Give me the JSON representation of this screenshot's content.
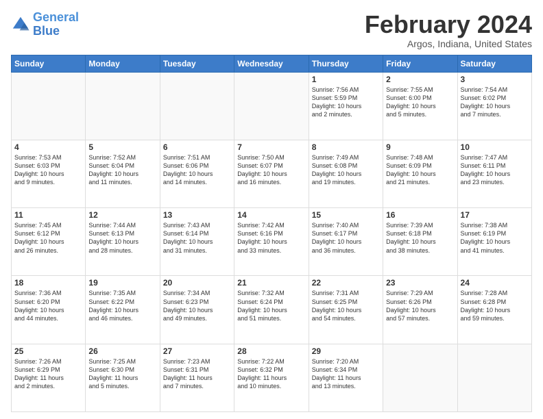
{
  "logo": {
    "line1": "General",
    "line2": "Blue"
  },
  "title": "February 2024",
  "subtitle": "Argos, Indiana, United States",
  "days_of_week": [
    "Sunday",
    "Monday",
    "Tuesday",
    "Wednesday",
    "Thursday",
    "Friday",
    "Saturday"
  ],
  "weeks": [
    [
      {
        "day": "",
        "info": ""
      },
      {
        "day": "",
        "info": ""
      },
      {
        "day": "",
        "info": ""
      },
      {
        "day": "",
        "info": ""
      },
      {
        "day": "1",
        "info": "Sunrise: 7:56 AM\nSunset: 5:59 PM\nDaylight: 10 hours\nand 2 minutes."
      },
      {
        "day": "2",
        "info": "Sunrise: 7:55 AM\nSunset: 6:00 PM\nDaylight: 10 hours\nand 5 minutes."
      },
      {
        "day": "3",
        "info": "Sunrise: 7:54 AM\nSunset: 6:02 PM\nDaylight: 10 hours\nand 7 minutes."
      }
    ],
    [
      {
        "day": "4",
        "info": "Sunrise: 7:53 AM\nSunset: 6:03 PM\nDaylight: 10 hours\nand 9 minutes."
      },
      {
        "day": "5",
        "info": "Sunrise: 7:52 AM\nSunset: 6:04 PM\nDaylight: 10 hours\nand 11 minutes."
      },
      {
        "day": "6",
        "info": "Sunrise: 7:51 AM\nSunset: 6:06 PM\nDaylight: 10 hours\nand 14 minutes."
      },
      {
        "day": "7",
        "info": "Sunrise: 7:50 AM\nSunset: 6:07 PM\nDaylight: 10 hours\nand 16 minutes."
      },
      {
        "day": "8",
        "info": "Sunrise: 7:49 AM\nSunset: 6:08 PM\nDaylight: 10 hours\nand 19 minutes."
      },
      {
        "day": "9",
        "info": "Sunrise: 7:48 AM\nSunset: 6:09 PM\nDaylight: 10 hours\nand 21 minutes."
      },
      {
        "day": "10",
        "info": "Sunrise: 7:47 AM\nSunset: 6:11 PM\nDaylight: 10 hours\nand 23 minutes."
      }
    ],
    [
      {
        "day": "11",
        "info": "Sunrise: 7:45 AM\nSunset: 6:12 PM\nDaylight: 10 hours\nand 26 minutes."
      },
      {
        "day": "12",
        "info": "Sunrise: 7:44 AM\nSunset: 6:13 PM\nDaylight: 10 hours\nand 28 minutes."
      },
      {
        "day": "13",
        "info": "Sunrise: 7:43 AM\nSunset: 6:14 PM\nDaylight: 10 hours\nand 31 minutes."
      },
      {
        "day": "14",
        "info": "Sunrise: 7:42 AM\nSunset: 6:16 PM\nDaylight: 10 hours\nand 33 minutes."
      },
      {
        "day": "15",
        "info": "Sunrise: 7:40 AM\nSunset: 6:17 PM\nDaylight: 10 hours\nand 36 minutes."
      },
      {
        "day": "16",
        "info": "Sunrise: 7:39 AM\nSunset: 6:18 PM\nDaylight: 10 hours\nand 38 minutes."
      },
      {
        "day": "17",
        "info": "Sunrise: 7:38 AM\nSunset: 6:19 PM\nDaylight: 10 hours\nand 41 minutes."
      }
    ],
    [
      {
        "day": "18",
        "info": "Sunrise: 7:36 AM\nSunset: 6:20 PM\nDaylight: 10 hours\nand 44 minutes."
      },
      {
        "day": "19",
        "info": "Sunrise: 7:35 AM\nSunset: 6:22 PM\nDaylight: 10 hours\nand 46 minutes."
      },
      {
        "day": "20",
        "info": "Sunrise: 7:34 AM\nSunset: 6:23 PM\nDaylight: 10 hours\nand 49 minutes."
      },
      {
        "day": "21",
        "info": "Sunrise: 7:32 AM\nSunset: 6:24 PM\nDaylight: 10 hours\nand 51 minutes."
      },
      {
        "day": "22",
        "info": "Sunrise: 7:31 AM\nSunset: 6:25 PM\nDaylight: 10 hours\nand 54 minutes."
      },
      {
        "day": "23",
        "info": "Sunrise: 7:29 AM\nSunset: 6:26 PM\nDaylight: 10 hours\nand 57 minutes."
      },
      {
        "day": "24",
        "info": "Sunrise: 7:28 AM\nSunset: 6:28 PM\nDaylight: 10 hours\nand 59 minutes."
      }
    ],
    [
      {
        "day": "25",
        "info": "Sunrise: 7:26 AM\nSunset: 6:29 PM\nDaylight: 11 hours\nand 2 minutes."
      },
      {
        "day": "26",
        "info": "Sunrise: 7:25 AM\nSunset: 6:30 PM\nDaylight: 11 hours\nand 5 minutes."
      },
      {
        "day": "27",
        "info": "Sunrise: 7:23 AM\nSunset: 6:31 PM\nDaylight: 11 hours\nand 7 minutes."
      },
      {
        "day": "28",
        "info": "Sunrise: 7:22 AM\nSunset: 6:32 PM\nDaylight: 11 hours\nand 10 minutes."
      },
      {
        "day": "29",
        "info": "Sunrise: 7:20 AM\nSunset: 6:34 PM\nDaylight: 11 hours\nand 13 minutes."
      },
      {
        "day": "",
        "info": ""
      },
      {
        "day": "",
        "info": ""
      }
    ]
  ]
}
